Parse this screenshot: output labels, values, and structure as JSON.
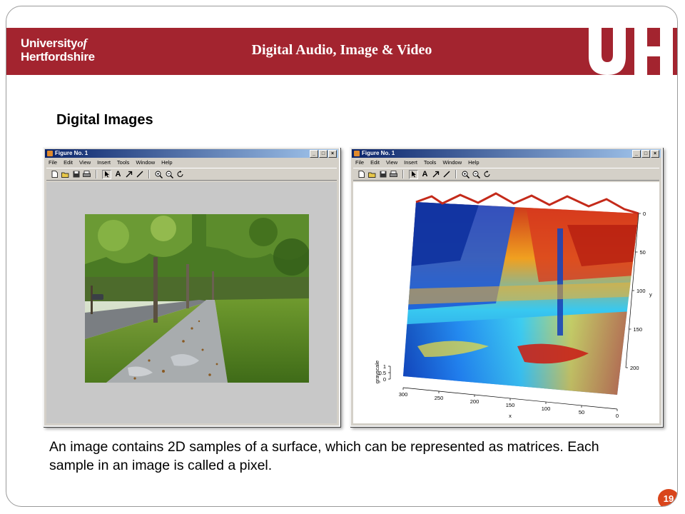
{
  "header": {
    "logo_line1": "University",
    "logo_line1_italic": "of",
    "logo_line2": "Hertfordshire",
    "title": "Digital Audio, Image & Video",
    "brand_color": "#a3242f"
  },
  "section_title": "Digital Images",
  "figures": [
    {
      "window_title": "Figure No. 1",
      "menu": [
        "File",
        "Edit",
        "View",
        "Insert",
        "Tools",
        "Window",
        "Help"
      ],
      "toolbar_icons": [
        "new-file-icon",
        "open-folder-icon",
        "save-icon",
        "print-icon",
        "pointer-icon",
        "text-icon",
        "arrow-icon",
        "line-icon",
        "zoom-in-icon",
        "zoom-out-icon",
        "rotate-icon"
      ],
      "content": "photo of a tree-lined footpath beside a road"
    },
    {
      "window_title": "Figure No. 1",
      "menu": [
        "File",
        "Edit",
        "View",
        "Insert",
        "Tools",
        "Window",
        "Help"
      ],
      "toolbar_icons": [
        "new-file-icon",
        "open-folder-icon",
        "save-icon",
        "print-icon",
        "pointer-icon",
        "text-icon",
        "arrow-icon",
        "line-icon",
        "zoom-in-icon",
        "zoom-out-icon",
        "rotate-icon"
      ]
    }
  ],
  "chart_data": {
    "type": "surface",
    "title": "",
    "xlabel": "x",
    "ylabel": "y",
    "zlabel": "grayscale",
    "x_ticks": [
      "300",
      "250",
      "200",
      "150",
      "100",
      "50",
      "0"
    ],
    "y_ticks": [
      "0",
      "50",
      "100",
      "150",
      "200"
    ],
    "z_ticks": [
      "1",
      "0.5",
      "0"
    ],
    "xlim": [
      0,
      300
    ],
    "ylim": [
      0,
      220
    ],
    "zlim": [
      0,
      1
    ],
    "colormap": "jet",
    "grid": false
  },
  "caption": "An image contains 2D samples of a surface, which can be represented as matrices. Each sample in an image is called a pixel.",
  "page_number": "19"
}
